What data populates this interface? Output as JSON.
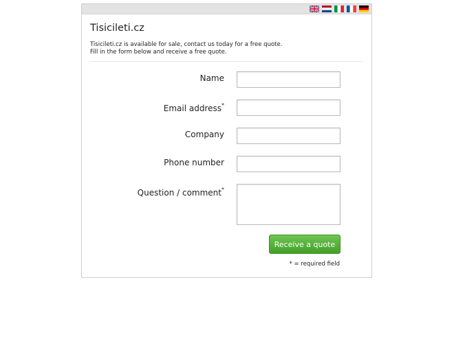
{
  "languages": [
    {
      "name": "flag-uk-icon"
    },
    {
      "name": "flag-nl-icon"
    },
    {
      "name": "flag-it-icon"
    },
    {
      "name": "flag-fr-icon"
    },
    {
      "name": "flag-de-icon"
    }
  ],
  "header": {
    "title": "Tisicileti.cz",
    "intro_line1": "Tisicileti.cz is available for sale, contact us today for a free quote.",
    "intro_line2": "Fill in the form below and receive a free quote."
  },
  "form": {
    "name_label": "Name",
    "email_label": "Email address",
    "email_marker": "*",
    "company_label": "Company",
    "phone_label": "Phone number",
    "comment_label": "Question / comment",
    "comment_marker": "*",
    "name_value": "",
    "email_value": "",
    "company_value": "",
    "phone_value": "",
    "comment_value": "",
    "submit_label": "Receive a quote",
    "required_note": "* = required field"
  },
  "colors": {
    "button": "#4fae33",
    "topbar": "#e3e3e3"
  }
}
